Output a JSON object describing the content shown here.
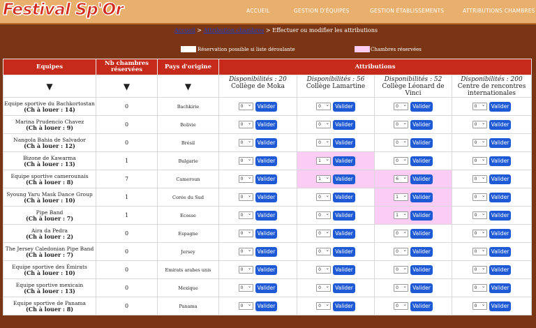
{
  "logo": "Festival Sp'Or",
  "nav": [
    "ACCUEIL",
    "GESTION D'ÉQUIPES",
    "GESTION ÉTABLISSEMENTS",
    "ATTRIBUTIONS CHAMBRES"
  ],
  "breadcrumb": {
    "home": "Accueil",
    "sep1": " > ",
    "section": "Attribution chambres",
    "sep2": " > ",
    "current": "Effectuer ou modifier les attributions"
  },
  "legend": {
    "available": "Réservation possible si liste déroulante",
    "reserved": "Chambres réservées",
    "reserved_color": "#fbcdf4"
  },
  "table": {
    "headers": {
      "team": "Equipes",
      "nb": "Nb chambres réservées",
      "country": "Pays d'origine",
      "attributions": "Attributions"
    },
    "arrow": "▼",
    "establishments": [
      {
        "dispo": "Disponibilités : 20",
        "name": "Collège de Moka"
      },
      {
        "dispo": "Disponibilités : 56",
        "name": "Collège Lamartine"
      },
      {
        "dispo": "Disponibilités : 52",
        "name": "Collège Léonard de Vinci"
      },
      {
        "dispo": "Disponibilités : 200",
        "name": "Centre de rencontres internationales"
      }
    ],
    "button_label": "Valider",
    "rows": [
      {
        "team": "Equipe sportive du Bachkortostan",
        "rent": "(Ch à louer : 14)",
        "nb": "0",
        "country": "Bachkirie",
        "cells": [
          "0",
          "0",
          "0",
          "0"
        ],
        "pink": [
          false,
          false,
          false,
          false
        ]
      },
      {
        "team": "Marina Prudencio Chavez",
        "rent": "(Ch à louer : 9)",
        "nb": "0",
        "country": "Bolivie",
        "cells": [
          "0",
          "0",
          "0",
          "0"
        ],
        "pink": [
          false,
          false,
          false,
          false
        ]
      },
      {
        "team": "Nangola Bahia de Salvador",
        "rent": "(Ch à louer : 12)",
        "nb": "0",
        "country": "Brésil",
        "cells": [
          "0",
          "0",
          "0",
          "0"
        ],
        "pink": [
          false,
          false,
          false,
          false
        ]
      },
      {
        "team": "Bizone de Kawarma",
        "rent": "(Ch à louer : 13)",
        "nb": "1",
        "country": "Bulgarie",
        "cells": [
          "0",
          "1",
          "0",
          "0"
        ],
        "pink": [
          false,
          true,
          false,
          false
        ]
      },
      {
        "team": "Equipe sportive camerounais",
        "rent": "(Ch à louer : 8)",
        "nb": "7",
        "country": "Cameroun",
        "cells": [
          "0",
          "1",
          "6",
          "0"
        ],
        "pink": [
          false,
          true,
          true,
          false
        ]
      },
      {
        "team": "Syoung Yaru Mask Dance Group",
        "rent": "(Ch à louer : 10)",
        "nb": "1",
        "country": "Corée du Sud",
        "cells": [
          "0",
          "0",
          "1",
          "0"
        ],
        "pink": [
          false,
          false,
          true,
          false
        ]
      },
      {
        "team": "Pipe Band",
        "rent": "(Ch à louer : 7)",
        "nb": "1",
        "country": "Ecosse",
        "cells": [
          "0",
          "0",
          "1",
          "0"
        ],
        "pink": [
          false,
          false,
          true,
          false
        ]
      },
      {
        "team": "Aira da Pedra",
        "rent": "(Ch à louer : 2)",
        "nb": "0",
        "country": "Espagne",
        "cells": [
          "0",
          "0",
          "0",
          "0"
        ],
        "pink": [
          false,
          false,
          false,
          false
        ]
      },
      {
        "team": "The Jersey Caledonian Pipe Band",
        "rent": "(Ch à louer : 7)",
        "nb": "0",
        "country": "Jersey",
        "cells": [
          "0",
          "0",
          "0",
          "0"
        ],
        "pink": [
          false,
          false,
          false,
          false
        ]
      },
      {
        "team": "Equipe sportive des Émirats",
        "rent": "(Ch à louer : 10)",
        "nb": "0",
        "country": "Emirats arabes unis",
        "cells": [
          "0",
          "0",
          "0",
          "0"
        ],
        "pink": [
          false,
          false,
          false,
          false
        ]
      },
      {
        "team": "Equipe sportive mexicain",
        "rent": "(Ch à louer : 13)",
        "nb": "0",
        "country": "Mexique",
        "cells": [
          "0",
          "0",
          "0",
          "0"
        ],
        "pink": [
          false,
          false,
          false,
          false
        ]
      },
      {
        "team": "Equipe sportive de Panama",
        "rent": "(Ch à louer : 8)",
        "nb": "0",
        "country": "Panama",
        "cells": [
          "0",
          "0",
          "0",
          "0"
        ],
        "pink": [
          false,
          false,
          false,
          false
        ]
      }
    ]
  }
}
